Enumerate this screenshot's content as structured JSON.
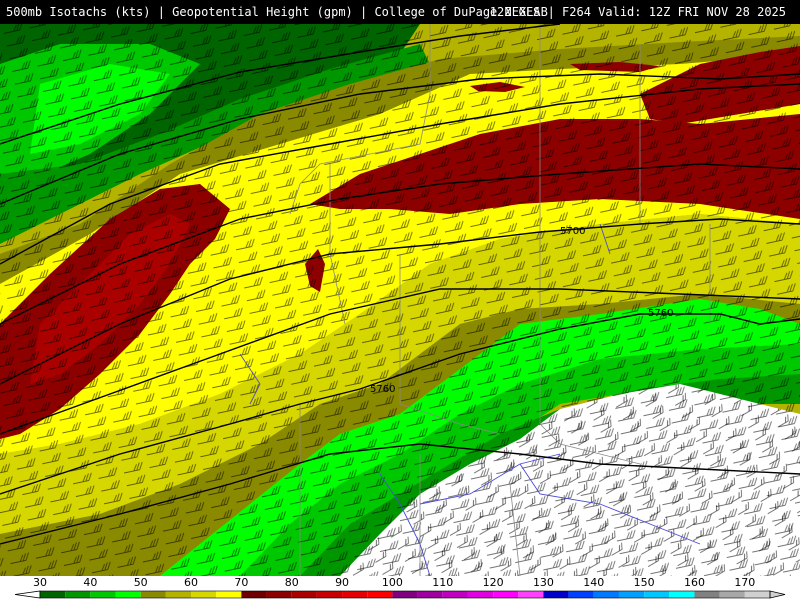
{
  "header": {
    "left_title": "500mb Isotachs (kts) | Geopotential Height (gpm) | College of DuPage NEXLAB",
    "right_title": "12Z GFS | F264 Valid: 12Z FRI NOV 28 2025"
  },
  "map": {
    "contour_labels": [
      "5700",
      "5760",
      "5760"
    ],
    "line_color": "#000000",
    "state_border_color": "#888888",
    "river_color": "#4a4ad8"
  },
  "legend": {
    "tick_labels": [
      "30",
      "40",
      "50",
      "60",
      "70",
      "80",
      "90",
      "100",
      "110",
      "120",
      "130",
      "140",
      "150",
      "160",
      "170"
    ],
    "bins": [
      {
        "from": 30,
        "to": 35,
        "color": "#006400"
      },
      {
        "from": 35,
        "to": 40,
        "color": "#009600"
      },
      {
        "from": 40,
        "to": 45,
        "color": "#00c800"
      },
      {
        "from": 45,
        "to": 50,
        "color": "#00ff00"
      },
      {
        "from": 50,
        "to": 55,
        "color": "#8a8a00"
      },
      {
        "from": 55,
        "to": 60,
        "color": "#b4b400"
      },
      {
        "from": 60,
        "to": 65,
        "color": "#d6d600"
      },
      {
        "from": 65,
        "to": 70,
        "color": "#ffff00"
      },
      {
        "from": 70,
        "to": 75,
        "color": "#6e0000"
      },
      {
        "from": 75,
        "to": 80,
        "color": "#8c0000"
      },
      {
        "from": 80,
        "to": 85,
        "color": "#aa0000"
      },
      {
        "from": 85,
        "to": 90,
        "color": "#c80000"
      },
      {
        "from": 90,
        "to": 95,
        "color": "#e60000"
      },
      {
        "from": 95,
        "to": 100,
        "color": "#ff0000"
      },
      {
        "from": 100,
        "to": 105,
        "color": "#800080"
      },
      {
        "from": 105,
        "to": 110,
        "color": "#a000a0"
      },
      {
        "from": 110,
        "to": 115,
        "color": "#c000c0"
      },
      {
        "from": 115,
        "to": 120,
        "color": "#e000e0"
      },
      {
        "from": 120,
        "to": 125,
        "color": "#ff00ff"
      },
      {
        "from": 125,
        "to": 130,
        "color": "#ff40ff"
      },
      {
        "from": 130,
        "to": 135,
        "color": "#0000c8"
      },
      {
        "from": 135,
        "to": 140,
        "color": "#0040ff"
      },
      {
        "from": 140,
        "to": 145,
        "color": "#0078ff"
      },
      {
        "from": 145,
        "to": 150,
        "color": "#00a0ff"
      },
      {
        "from": 150,
        "to": 155,
        "color": "#00c8ff"
      },
      {
        "from": 155,
        "to": 160,
        "color": "#00ffff"
      },
      {
        "from": 160,
        "to": 165,
        "color": "#808080"
      },
      {
        "from": 165,
        "to": 170,
        "color": "#a8a8a8"
      },
      {
        "from": 170,
        "to": 175,
        "color": "#d0d0d0"
      }
    ]
  }
}
